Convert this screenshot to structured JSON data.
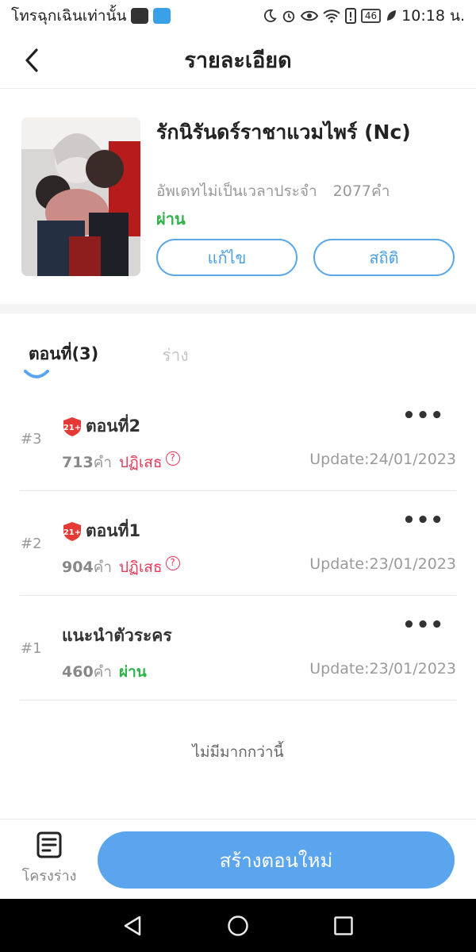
{
  "status_bar": {
    "carrier_text": "โทรฉุกเฉินเท่านั้น",
    "battery": "46",
    "time": "10:18 น."
  },
  "header": {
    "title": "รายละเอียด",
    "back_icon": "chevron-left-icon"
  },
  "book": {
    "title": "รักนิรันดร์ราชาแวมไพร์ (Nc)",
    "schedule": "อัพเดทไม่เป็นเวลาประจำ",
    "word_count": "2077คำ",
    "status": "ผ่าน",
    "edit_label": "แก้ไข",
    "stats_label": "สถิติ"
  },
  "tabs": [
    {
      "label": "ตอนที่(3)",
      "active": true
    },
    {
      "label": "ร่าง",
      "active": false
    }
  ],
  "episodes": [
    {
      "index": "#3",
      "title": "ตอนที่2",
      "rating_badge": "21+",
      "words": "713",
      "words_unit": "คำ",
      "status": "ปฏิเสธ",
      "update": "Update:24/01/2023"
    },
    {
      "index": "#2",
      "title": "ตอนที่1",
      "rating_badge": "21+",
      "words": "904",
      "words_unit": "คำ",
      "status": "ปฏิเสธ",
      "update": "Update:23/01/2023"
    },
    {
      "index": "#1",
      "title": "แนะนำตัวระคร",
      "rating_badge": "",
      "words": "460",
      "words_unit": "คำ",
      "status": "ผ่าน",
      "update": "Update:23/01/2023"
    }
  ],
  "no_more_text": "ไม่มีมากกว่านี้",
  "bottom": {
    "draft_label": "โครงร่าง",
    "create_label": "สร้างตอนใหม่"
  },
  "colors": {
    "accent": "#5aa5ee",
    "pass": "#2fb24a",
    "reject": "#e83b5a"
  }
}
